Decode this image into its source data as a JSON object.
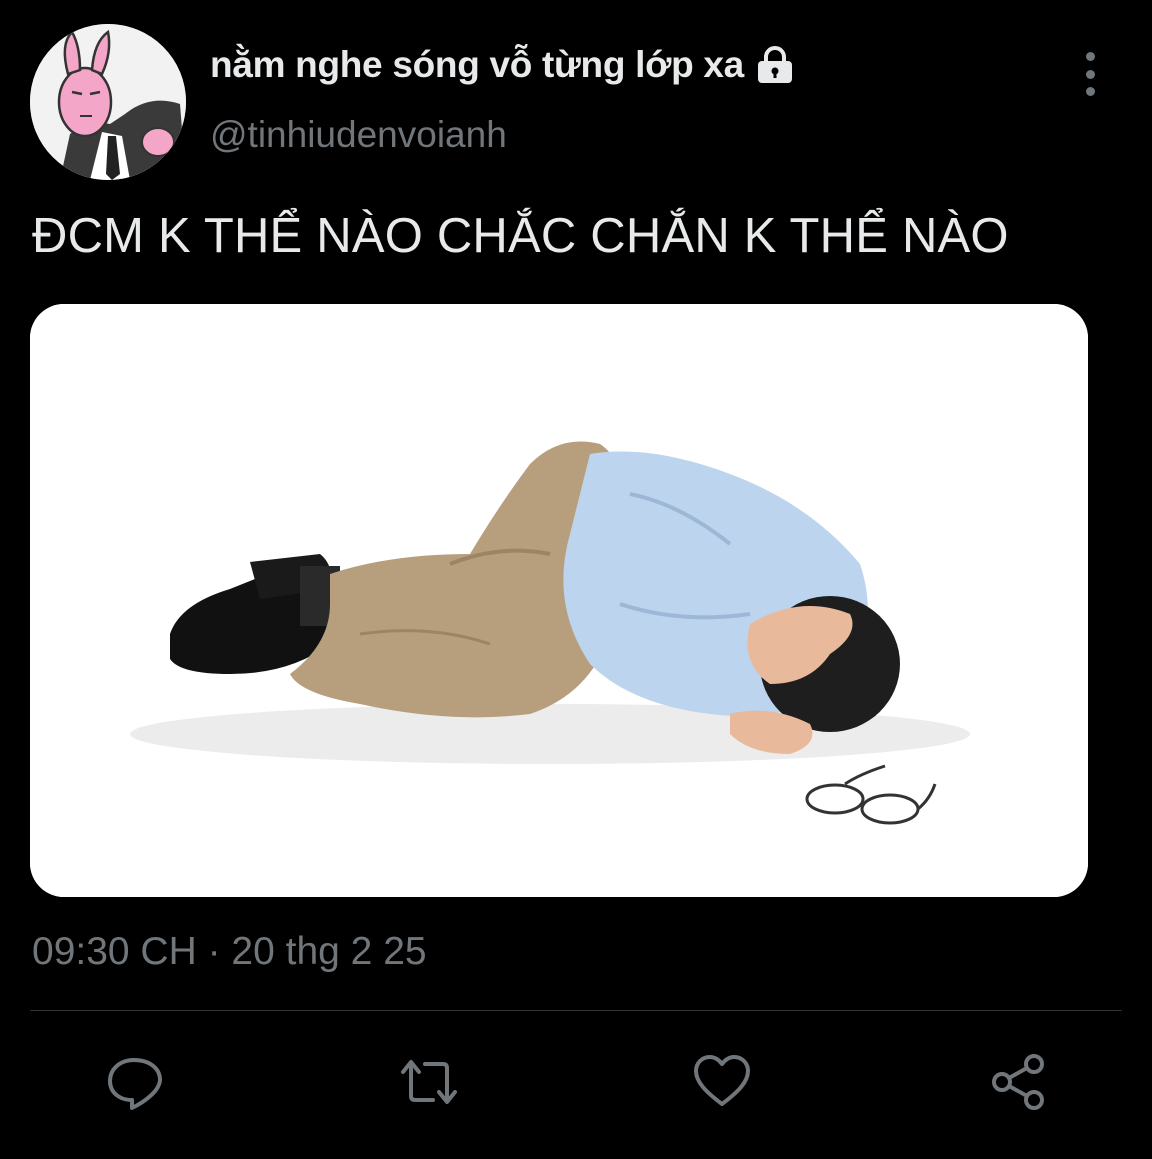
{
  "author": {
    "display_name": "nằm nghe sóng vỗ từng lớp xa",
    "handle": "@tinhiudenvoianh",
    "protected_icon": "lock-icon"
  },
  "tweet": {
    "text": "ĐCM K THỂ NÀO CHẮC CHẮN K THỂ NÀO",
    "timestamp": "09:30 CH · 20 thg 2 25"
  },
  "actions": [
    {
      "name": "reply",
      "icon": "reply-icon"
    },
    {
      "name": "retweet",
      "icon": "retweet-icon"
    },
    {
      "name": "like",
      "icon": "heart-icon"
    },
    {
      "name": "share",
      "icon": "share-icon"
    }
  ],
  "colors": {
    "background": "#000000",
    "primary_text": "#e7e9ea",
    "secondary_text": "#71767b",
    "divider": "#2f3336"
  }
}
